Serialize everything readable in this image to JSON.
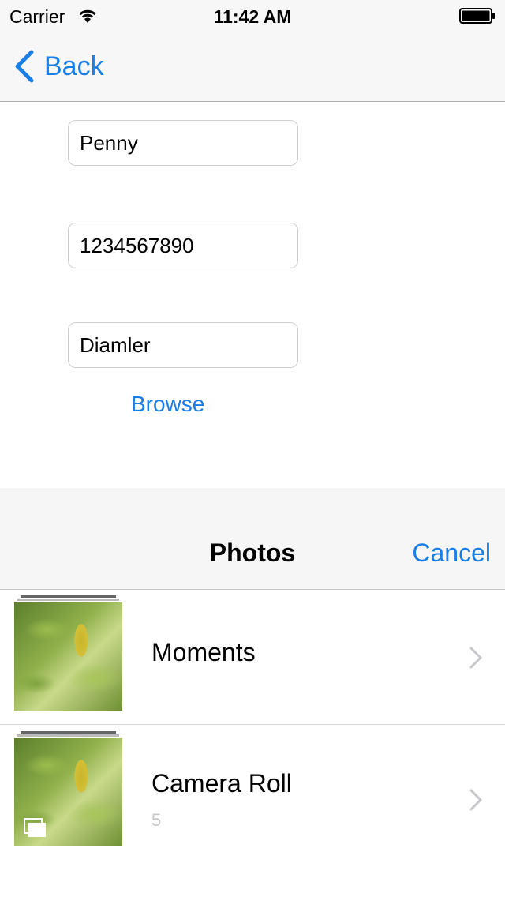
{
  "status_bar": {
    "carrier": "Carrier",
    "time": "11:42 AM"
  },
  "nav": {
    "back_label": "Back"
  },
  "form": {
    "name_value": "Penny",
    "phone_value": "1234567890",
    "company_value": "Diamler",
    "browse_label": "Browse"
  },
  "picker": {
    "title": "Photos",
    "cancel_label": "Cancel",
    "albums": [
      {
        "label": "Moments",
        "count": ""
      },
      {
        "label": "Camera Roll",
        "count": "5"
      }
    ]
  },
  "colors": {
    "accent": "#1a7ee9",
    "nav_background": "#f7f7f7",
    "count_text": "#c8c8c8"
  }
}
